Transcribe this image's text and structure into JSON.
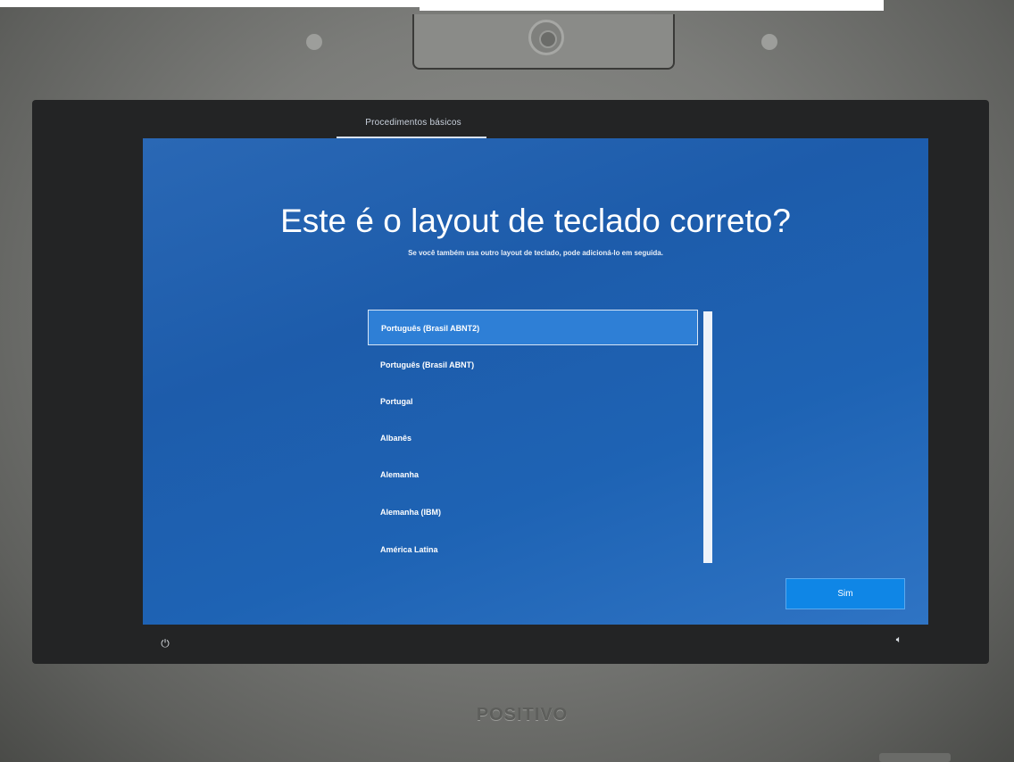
{
  "header": {
    "tab_label": "Procedimentos básicos"
  },
  "main": {
    "title": "Este é o layout de teclado correto?",
    "subtitle": "Se você também usa outro layout de teclado, pode adicioná-lo em seguida."
  },
  "keyboard_layouts": {
    "selected_index": 0,
    "items": [
      {
        "label": "Português (Brasil ABNT2)"
      },
      {
        "label": "Português (Brasil ABNT)"
      },
      {
        "label": "Portugal"
      },
      {
        "label": "Albanês"
      },
      {
        "label": "Alemanha"
      },
      {
        "label": "Alemanha (IBM)"
      },
      {
        "label": "América Latina"
      }
    ]
  },
  "footer": {
    "next_label": "Sim",
    "power_icon": "power-icon",
    "volume_icon": "volume-icon"
  },
  "device": {
    "brand": "POSITIVO"
  },
  "colors": {
    "oobe_blue": "#1d5cab",
    "selected_item": "#2e7fd6",
    "button_blue": "#0f86e6"
  }
}
